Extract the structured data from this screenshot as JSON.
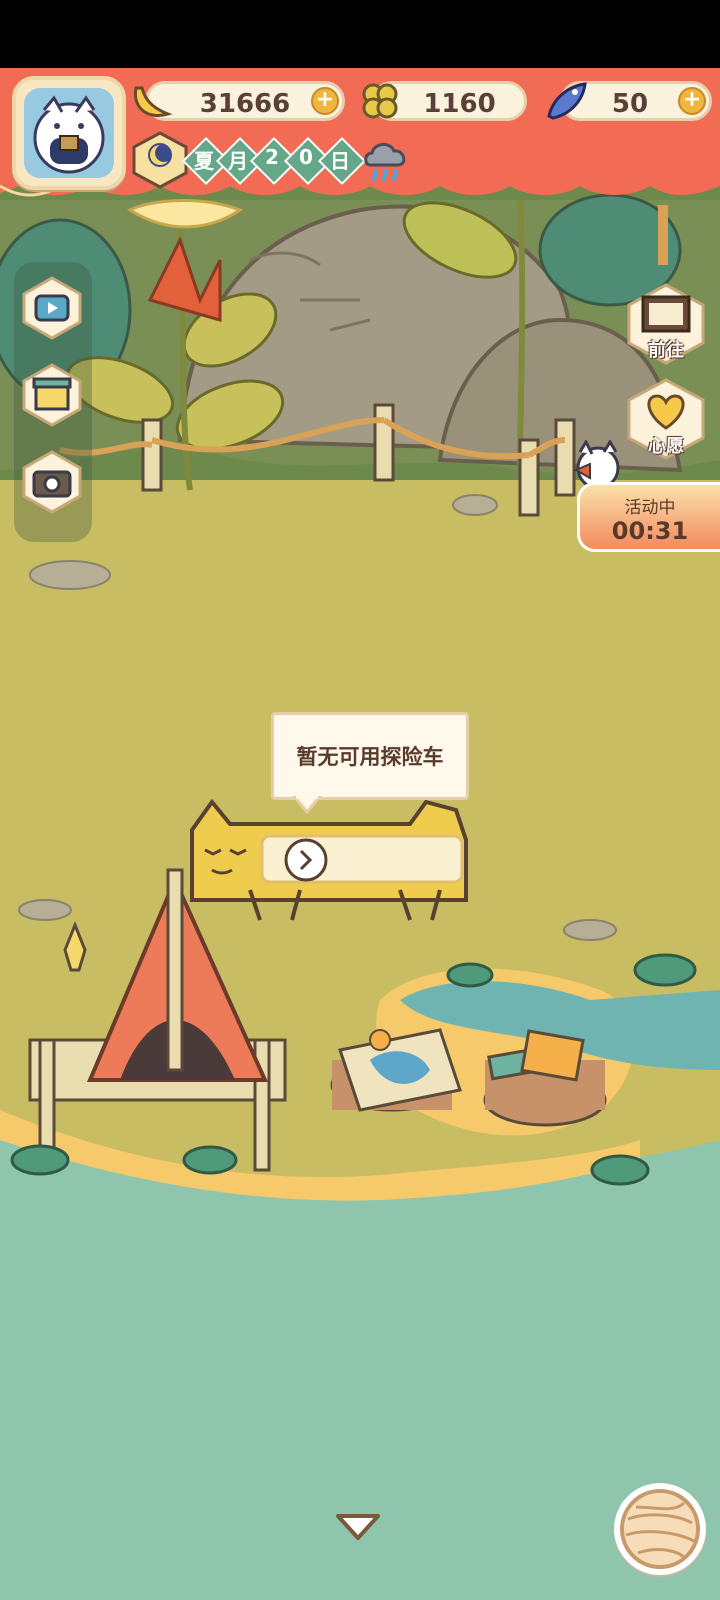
{
  "resources": {
    "banana": {
      "value": "31666",
      "icon": "banana-icon"
    },
    "clover": {
      "value": "1160",
      "icon": "clover-icon"
    },
    "fish": {
      "value": "50",
      "icon": "fish-icon"
    }
  },
  "date": {
    "chars": [
      "夏",
      "月",
      "2",
      "0",
      "日"
    ],
    "weather_icon": "rain-cloud-icon"
  },
  "right_buttons": {
    "goto_label": "前往",
    "wish_label": "心愿"
  },
  "event": {
    "title": "活动中",
    "timer": "00:31"
  },
  "tooltip": {
    "text": "暂无可用探险车"
  },
  "colors": {
    "banner": "#f26b55",
    "ground": "#c9bd63",
    "water": "#8fc4ad",
    "accent": "#f0b63c"
  }
}
